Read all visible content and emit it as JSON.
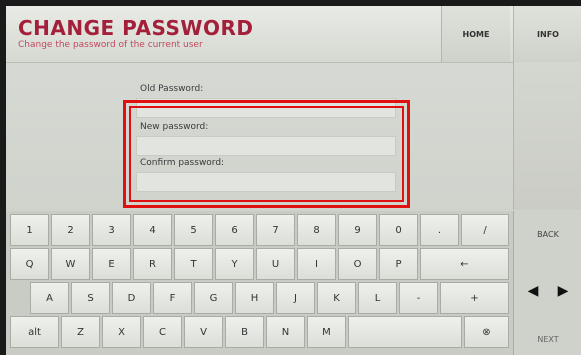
{
  "header": {
    "title": "CHANGE PASSWORD",
    "subtitle": "Change the password of the current user",
    "home_label": "HOME",
    "info_label": "INFO"
  },
  "form": {
    "old_password_label": "Old Password:",
    "new_password_label": "New password:",
    "confirm_password_label": "Confirm password:"
  },
  "keyboard": {
    "row1": [
      "1",
      "2",
      "3",
      "4",
      "5",
      "6",
      "7",
      "8",
      "9",
      "0",
      ".",
      "/"
    ],
    "row2": [
      "Q",
      "W",
      "E",
      "R",
      "T",
      "Y",
      "U",
      "I",
      "O",
      "P",
      "←"
    ],
    "row3": [
      "A",
      "S",
      "D",
      "F",
      "G",
      "H",
      "J",
      "K",
      "L",
      "-",
      "+"
    ],
    "row4": [
      "alt",
      "Z",
      "X",
      "C",
      "V",
      "B",
      "N",
      "M",
      "",
      "⊗"
    ],
    "back_label": "BACK",
    "next_label": "NEXT",
    "left_arrow": "◀",
    "right_arrow": "▶"
  },
  "colors": {
    "title": "#a31f3a",
    "highlight": "#e01010"
  }
}
